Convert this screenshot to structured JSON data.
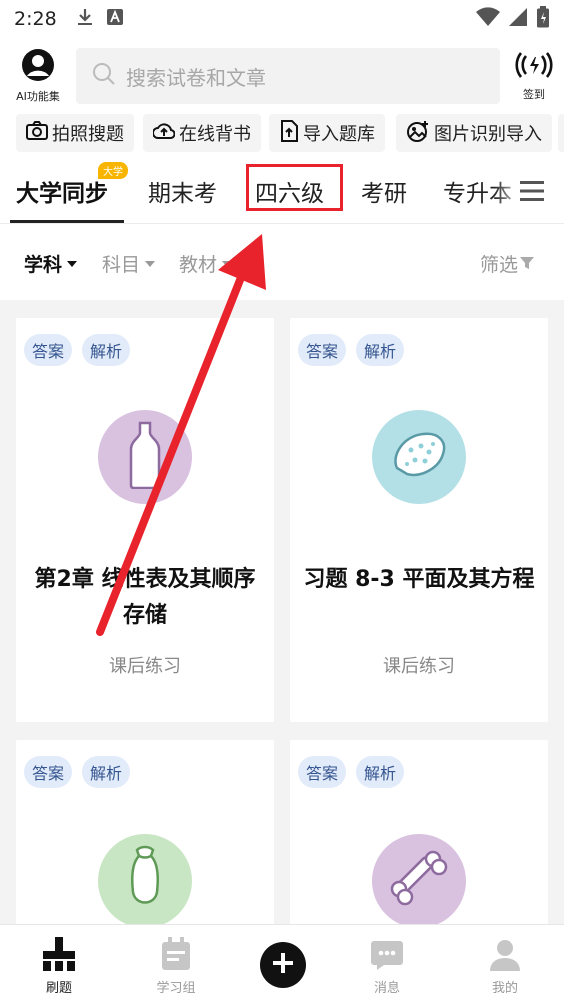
{
  "status_bar": {
    "time": "2:28"
  },
  "top_bar": {
    "ai_label": "AI功能集",
    "search_placeholder": "搜索试卷和文章",
    "signin_label": "签到"
  },
  "tools": [
    {
      "label": "拍照搜题",
      "icon": "camera-icon"
    },
    {
      "label": "在线背书",
      "icon": "cloud-upload-icon"
    },
    {
      "label": "导入题库",
      "icon": "file-import-icon"
    },
    {
      "label": "图片识别导入",
      "icon": "image-scan-icon"
    }
  ],
  "tabs": [
    {
      "label": "大学同步",
      "badge": "大学",
      "active": true
    },
    {
      "label": "期末考"
    },
    {
      "label": "四六级",
      "highlighted": true
    },
    {
      "label": "考研"
    },
    {
      "label": "专升本"
    }
  ],
  "filters": {
    "subject": "学科",
    "course": "科目",
    "textbook": "教材",
    "screen": "筛选"
  },
  "cards": [
    {
      "tags": [
        "答案",
        "解析"
      ],
      "title": "第2章 线性表及其顺序存储",
      "subtitle": "课后练习",
      "icon": "bottle-icon",
      "color": "#d9c1e0"
    },
    {
      "tags": [
        "答案",
        "解析"
      ],
      "title": "习题 8-3 平面及其方程",
      "subtitle": "课后练习",
      "icon": "melon-icon",
      "color": "#b3e0e6"
    },
    {
      "tags": [
        "答案",
        "解析"
      ],
      "title": "",
      "subtitle": "",
      "icon": "eggplant-icon",
      "color": "#c9e6c4"
    },
    {
      "tags": [
        "答案",
        "解析"
      ],
      "title": "",
      "subtitle": "",
      "icon": "bone-icon",
      "color": "#d9c1e0"
    }
  ],
  "bottom_nav": [
    {
      "label": "刷题",
      "icon": "brush-icon",
      "active": true
    },
    {
      "label": "学习组",
      "icon": "calendar-icon"
    },
    {
      "label": "",
      "icon": "plus-icon"
    },
    {
      "label": "消息",
      "icon": "chat-icon"
    },
    {
      "label": "我的",
      "icon": "person-icon"
    }
  ],
  "colors": {
    "highlight_red": "#e8232b",
    "tag_bg": "#e2ebfa",
    "tag_text": "#34558f",
    "badge_yellow": "#f7b500"
  }
}
